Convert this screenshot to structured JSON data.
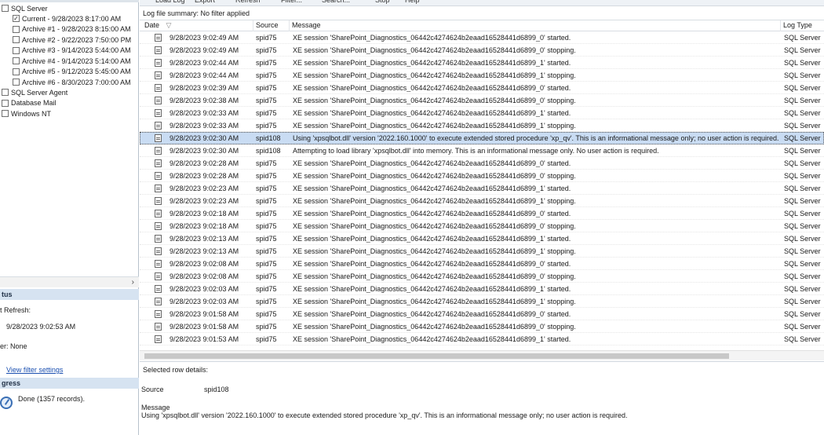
{
  "toolbar": {
    "items": [
      "Load Log",
      "Export",
      "Refresh",
      "Filter...",
      "Search...",
      "Stop",
      "Help"
    ]
  },
  "tree": {
    "sql_server": {
      "label": "SQL Server",
      "checked": false
    },
    "logs": [
      {
        "label": "Current - 9/28/2023 8:17:00 AM",
        "checked": true
      },
      {
        "label": "Archive #1 - 9/28/2023 8:15:00 AM",
        "checked": false
      },
      {
        "label": "Archive #2 - 9/22/2023 7:50:00 PM",
        "checked": false
      },
      {
        "label": "Archive #3 - 9/14/2023 5:44:00 AM",
        "checked": false
      },
      {
        "label": "Archive #4 - 9/14/2023 5:14:00 AM",
        "checked": false
      },
      {
        "label": "Archive #5 - 9/12/2023 5:45:00 AM",
        "checked": false
      },
      {
        "label": "Archive #6 - 8/30/2023 7:00:00 AM",
        "checked": false
      }
    ],
    "others": [
      {
        "label": "SQL Server Agent"
      },
      {
        "label": "Database Mail"
      },
      {
        "label": "Windows NT"
      }
    ]
  },
  "status": {
    "header": "tus",
    "last_refresh_label": "t Refresh:",
    "last_refresh_value": "9/28/2023 9:02:53 AM",
    "filter_label": "er: None",
    "view_filter_link": "View filter settings"
  },
  "progress": {
    "header": "gress",
    "done_text": "Done (1357 records)."
  },
  "summary": "Log file summary: No filter applied",
  "grid": {
    "columns": {
      "date": "Date",
      "source": "Source",
      "message": "Message",
      "log_type": "Log Type"
    },
    "rows": [
      {
        "date": "9/28/2023 9:02:49 AM",
        "source": "spid75",
        "message": "XE session 'SharePoint_Diagnostics_06442c4274624b2eaad16528441d6899_0' started.",
        "type": "SQL Server"
      },
      {
        "date": "9/28/2023 9:02:49 AM",
        "source": "spid75",
        "message": "XE session 'SharePoint_Diagnostics_06442c4274624b2eaad16528441d6899_0' stopping.",
        "type": "SQL Server"
      },
      {
        "date": "9/28/2023 9:02:44 AM",
        "source": "spid75",
        "message": "XE session 'SharePoint_Diagnostics_06442c4274624b2eaad16528441d6899_1' started.",
        "type": "SQL Server"
      },
      {
        "date": "9/28/2023 9:02:44 AM",
        "source": "spid75",
        "message": "XE session 'SharePoint_Diagnostics_06442c4274624b2eaad16528441d6899_1' stopping.",
        "type": "SQL Server"
      },
      {
        "date": "9/28/2023 9:02:39 AM",
        "source": "spid75",
        "message": "XE session 'SharePoint_Diagnostics_06442c4274624b2eaad16528441d6899_0' started.",
        "type": "SQL Server"
      },
      {
        "date": "9/28/2023 9:02:38 AM",
        "source": "spid75",
        "message": "XE session 'SharePoint_Diagnostics_06442c4274624b2eaad16528441d6899_0' stopping.",
        "type": "SQL Server"
      },
      {
        "date": "9/28/2023 9:02:33 AM",
        "source": "spid75",
        "message": "XE session 'SharePoint_Diagnostics_06442c4274624b2eaad16528441d6899_1' started.",
        "type": "SQL Server"
      },
      {
        "date": "9/28/2023 9:02:33 AM",
        "source": "spid75",
        "message": "XE session 'SharePoint_Diagnostics_06442c4274624b2eaad16528441d6899_1' stopping.",
        "type": "SQL Server"
      },
      {
        "date": "9/28/2023 9:02:30 AM",
        "source": "spid108",
        "message": "Using 'xpsqlbot.dll' version '2022.160.1000' to execute extended stored procedure 'xp_qv'. This is an informational message only; no user action is required.",
        "type": "SQL Server",
        "selected": true
      },
      {
        "date": "9/28/2023 9:02:30 AM",
        "source": "spid108",
        "message": "Attempting to load library 'xpsqlbot.dll' into memory. This is an informational message only. No user action is required.",
        "type": "SQL Server"
      },
      {
        "date": "9/28/2023 9:02:28 AM",
        "source": "spid75",
        "message": "XE session 'SharePoint_Diagnostics_06442c4274624b2eaad16528441d6899_0' started.",
        "type": "SQL Server"
      },
      {
        "date": "9/28/2023 9:02:28 AM",
        "source": "spid75",
        "message": "XE session 'SharePoint_Diagnostics_06442c4274624b2eaad16528441d6899_0' stopping.",
        "type": "SQL Server"
      },
      {
        "date": "9/28/2023 9:02:23 AM",
        "source": "spid75",
        "message": "XE session 'SharePoint_Diagnostics_06442c4274624b2eaad16528441d6899_1' started.",
        "type": "SQL Server"
      },
      {
        "date": "9/28/2023 9:02:23 AM",
        "source": "spid75",
        "message": "XE session 'SharePoint_Diagnostics_06442c4274624b2eaad16528441d6899_1' stopping.",
        "type": "SQL Server"
      },
      {
        "date": "9/28/2023 9:02:18 AM",
        "source": "spid75",
        "message": "XE session 'SharePoint_Diagnostics_06442c4274624b2eaad16528441d6899_0' started.",
        "type": "SQL Server"
      },
      {
        "date": "9/28/2023 9:02:18 AM",
        "source": "spid75",
        "message": "XE session 'SharePoint_Diagnostics_06442c4274624b2eaad16528441d6899_0' stopping.",
        "type": "SQL Server"
      },
      {
        "date": "9/28/2023 9:02:13 AM",
        "source": "spid75",
        "message": "XE session 'SharePoint_Diagnostics_06442c4274624b2eaad16528441d6899_1' started.",
        "type": "SQL Server"
      },
      {
        "date": "9/28/2023 9:02:13 AM",
        "source": "spid75",
        "message": "XE session 'SharePoint_Diagnostics_06442c4274624b2eaad16528441d6899_1' stopping.",
        "type": "SQL Server"
      },
      {
        "date": "9/28/2023 9:02:08 AM",
        "source": "spid75",
        "message": "XE session 'SharePoint_Diagnostics_06442c4274624b2eaad16528441d6899_0' started.",
        "type": "SQL Server"
      },
      {
        "date": "9/28/2023 9:02:08 AM",
        "source": "spid75",
        "message": "XE session 'SharePoint_Diagnostics_06442c4274624b2eaad16528441d6899_0' stopping.",
        "type": "SQL Server"
      },
      {
        "date": "9/28/2023 9:02:03 AM",
        "source": "spid75",
        "message": "XE session 'SharePoint_Diagnostics_06442c4274624b2eaad16528441d6899_1' started.",
        "type": "SQL Server"
      },
      {
        "date": "9/28/2023 9:02:03 AM",
        "source": "spid75",
        "message": "XE session 'SharePoint_Diagnostics_06442c4274624b2eaad16528441d6899_1' stopping.",
        "type": "SQL Server"
      },
      {
        "date": "9/28/2023 9:01:58 AM",
        "source": "spid75",
        "message": "XE session 'SharePoint_Diagnostics_06442c4274624b2eaad16528441d6899_0' started.",
        "type": "SQL Server"
      },
      {
        "date": "9/28/2023 9:01:58 AM",
        "source": "spid75",
        "message": "XE session 'SharePoint_Diagnostics_06442c4274624b2eaad16528441d6899_0' stopping.",
        "type": "SQL Server"
      },
      {
        "date": "9/28/2023 9:01:53 AM",
        "source": "spid75",
        "message": "XE session 'SharePoint_Diagnostics_06442c4274624b2eaad16528441d6899_1' started.",
        "type": "SQL Server"
      }
    ]
  },
  "details": {
    "title": "Selected row details:",
    "source_label": "Source",
    "source_value": "spid108",
    "message_label": "Message",
    "message_value": "Using 'xpsqlbot.dll' version '2022.160.1000' to execute extended stored procedure 'xp_qv'. This is an informational message only; no user action is required."
  },
  "colors": {
    "selected_row": "#c9dcf3",
    "section_header": "#d6e3f1",
    "link": "#1a4fb0"
  }
}
